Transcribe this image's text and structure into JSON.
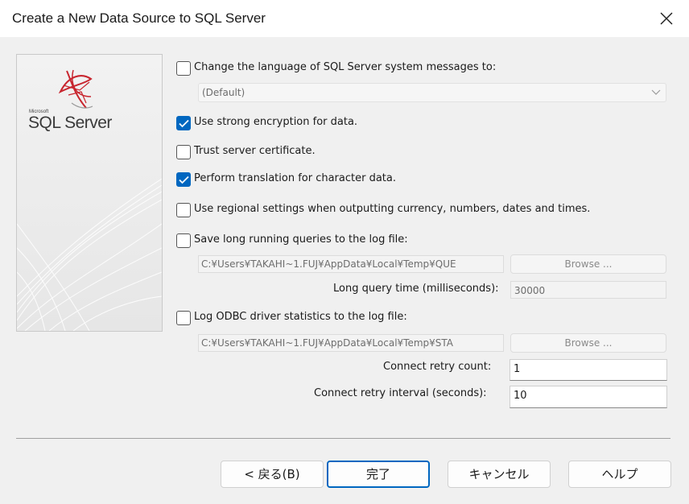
{
  "window": {
    "title": "Create a New Data Source to SQL Server"
  },
  "logo": {
    "small": "Microsoft",
    "name": "SQL Server"
  },
  "options": {
    "language": {
      "label": "Change the language of SQL Server system messages to:",
      "checked": false,
      "selected": "(Default)"
    },
    "strong_encryption": {
      "label": "Use strong encryption for data.",
      "checked": true
    },
    "trust_cert": {
      "label": "Trust server certificate.",
      "checked": false
    },
    "translation": {
      "label": "Perform translation for character data.",
      "checked": true
    },
    "regional": {
      "label": "Use regional settings when outputting currency, numbers, dates and times.",
      "checked": false
    },
    "long_queries": {
      "label": "Save long running queries to the log file:",
      "checked": false,
      "path": "C:¥Users¥TAKAHI~1.FUJ¥AppData¥Local¥Temp¥QUE",
      "browse": "Browse ...",
      "time_label": "Long query time (milliseconds):",
      "time_value": "30000"
    },
    "odbc_stats": {
      "label": "Log ODBC driver statistics to the log file:",
      "checked": false,
      "path": "C:¥Users¥TAKAHI~1.FUJ¥AppData¥Local¥Temp¥STA",
      "browse": "Browse ..."
    },
    "retry_count": {
      "label": "Connect retry count:",
      "value": "1"
    },
    "retry_interval": {
      "label": "Connect retry interval (seconds):",
      "value": "10"
    }
  },
  "buttons": {
    "back": "< 戻る(B)",
    "finish": "完了",
    "cancel": "キャンセル",
    "help": "ヘルプ"
  },
  "colors": {
    "accent": "#0067c0"
  }
}
